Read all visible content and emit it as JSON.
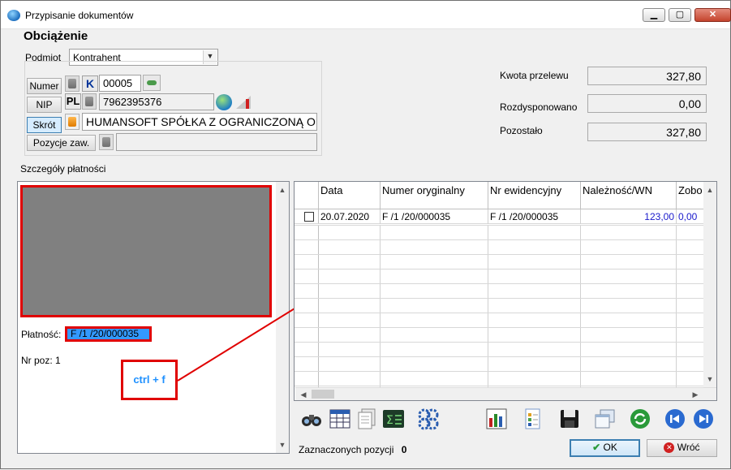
{
  "window": {
    "title": "Przypisanie dokumentów",
    "controls": {
      "minimize": "▁",
      "maximize": "▢",
      "close": "✕"
    }
  },
  "header": {
    "section_title": "Obciążenie"
  },
  "podmiot": {
    "label": "Podmiot",
    "value": "Kontrahent"
  },
  "contractor": {
    "numer_button": "Numer",
    "nip_button": "NIP",
    "skrot_button": "Skrót",
    "pozycje_button": "Pozycje zaw.",
    "type_code": "K",
    "number": "00005",
    "country": "PL",
    "nip": "7962395376",
    "name": "HUMANSOFT SPÓŁKA Z OGRANICZONĄ O",
    "pozycje_value": ""
  },
  "summary": {
    "kwota_label": "Kwota przelewu",
    "kwota_value": "327,80",
    "rozdysponowano_label": "Rozdysponowano",
    "rozdysponowano_value": "0,00",
    "pozostalo_label": "Pozostało",
    "pozostalo_value": "327,80"
  },
  "details": {
    "section_label": "Szczegóły płatności",
    "platnosc_label": "Płatność:",
    "platnosc_value": "F /1  /20/000035",
    "nrpoz_label": "Nr poz:",
    "nrpoz_value": "1",
    "callout_text": "ctrl + f"
  },
  "grid": {
    "columns": [
      "Data",
      "Numer oryginalny",
      "Nr ewidencyjny",
      "Należność/WN",
      "Zobo"
    ],
    "rows": [
      [
        "20.07.2020",
        "F /1  /20/000035",
        "F /1  /20/000035",
        "123,00",
        "0,00"
      ]
    ],
    "value_color": "#1a1acc"
  },
  "footer": {
    "selected_label": "Zaznaczonych pozycji",
    "selected_count": "0",
    "ok_label": "OK",
    "cancel_label": "Wróć"
  },
  "toolbar_icons": [
    "binoculars-icon",
    "table-icon",
    "documents-icon",
    "sigma-icon",
    "settings-icon",
    "chart-icon",
    "spreadsheet-icon",
    "save-icon",
    "windows-icon",
    "refresh-icon",
    "prev-icon",
    "next-icon"
  ],
  "colors": {
    "highlight": "#3399ff",
    "annotation_red": "#e00000",
    "callout_text": "#1e90ff"
  }
}
